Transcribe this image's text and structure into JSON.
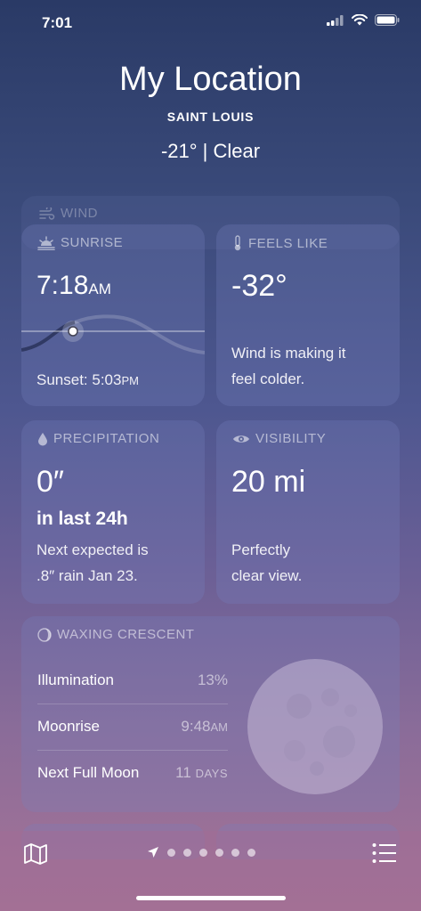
{
  "status": {
    "time": "7:01"
  },
  "location": {
    "title": "My Location",
    "city": "SAINT LOUIS",
    "conditions": "-21°  |  Clear"
  },
  "wind": {
    "label": "WIND"
  },
  "sunrise": {
    "label": "SUNRISE",
    "time": "7:18",
    "ampm": "AM",
    "sunset_prefix": "Sunset: 5:03",
    "sunset_ampm": "PM"
  },
  "feels_like": {
    "label": "FEELS LIKE",
    "value": "-32°",
    "desc_line1": "Wind is making it",
    "desc_line2": "feel colder."
  },
  "precipitation": {
    "label": "PRECIPITATION",
    "value": "0″",
    "period": "in last 24h",
    "desc_line1": "Next expected is",
    "desc_line2": ".8″ rain Jan 23."
  },
  "visibility": {
    "label": "VISIBILITY",
    "value": "20 mi",
    "desc_line1": "Perfectly",
    "desc_line2": "clear view."
  },
  "moon": {
    "label": "WAXING CRESCENT",
    "rows": [
      {
        "name": "Illumination",
        "value": "13%"
      },
      {
        "name": "Moonrise",
        "value": "9:48",
        "suffix": "AM"
      },
      {
        "name": "Next Full Moon",
        "value": "11",
        "suffix": "DAYS"
      }
    ]
  },
  "toolbar": {
    "page_count": 6,
    "current_page": 1
  },
  "icons": {
    "status": [
      "signal-icon",
      "wifi-icon",
      "battery-icon"
    ],
    "toolbar": [
      "map-icon",
      "location-arrow-icon",
      "list-icon"
    ]
  }
}
